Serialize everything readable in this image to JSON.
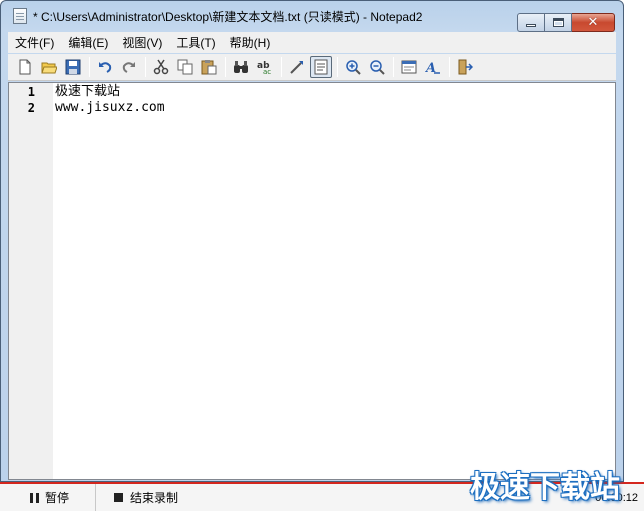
{
  "window": {
    "title": "* C:\\Users\\Administrator\\Desktop\\新建文本文档.txt (只读模式) - Notepad2",
    "close_glyph": "✕"
  },
  "menu": [
    {
      "label": "文件(F)"
    },
    {
      "label": "编辑(E)"
    },
    {
      "label": "视图(V)"
    },
    {
      "label": "工具(T)"
    },
    {
      "label": "帮助(H)"
    }
  ],
  "toolbar": {
    "icons": [
      "new-file-icon",
      "open-folder-icon",
      "save-icon",
      "undo-icon",
      "redo-icon",
      "cut-icon",
      "copy-icon",
      "paste-icon",
      "find-icon",
      "replace-icon",
      "wrap-icon",
      "view-whitespace-icon",
      "zoom-in-icon",
      "zoom-out-icon",
      "scheme-icon",
      "font-icon",
      "exit-icon"
    ],
    "active": "view-whitespace-icon"
  },
  "editor": {
    "lines": [
      {
        "number": "1",
        "text": "极速下载站"
      },
      {
        "number": "2",
        "text": "www.jisuxz.com"
      }
    ]
  },
  "recorder": {
    "pause_label": "暂停",
    "stop_label": "结束录制",
    "elapsed": "00:00:12"
  },
  "watermark": "极速下载站"
}
